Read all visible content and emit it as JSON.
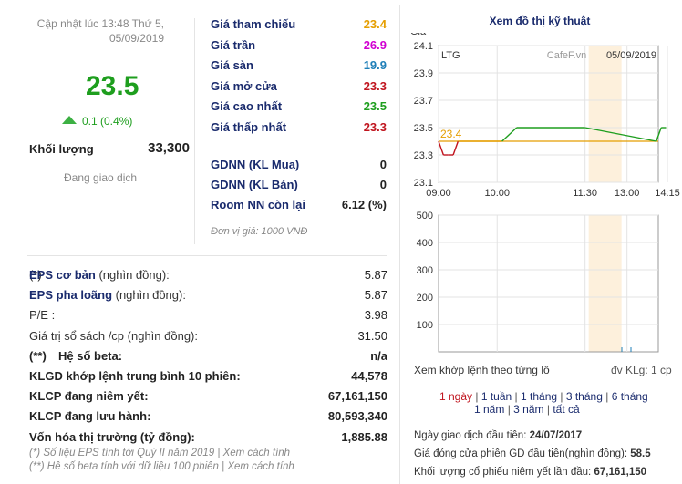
{
  "quote": {
    "updated_line1": "Cập nhật lúc 13:48 Thứ 5,",
    "updated_line2": "05/09/2019",
    "price": "23.5",
    "change": "0.1 (0.4%)",
    "volume_label": "Khối lượng",
    "volume": "33,300",
    "status": "Đang giao dịch"
  },
  "price_table": [
    {
      "label": "Giá tham chiếu",
      "value": "23.4",
      "color": "#e59e00"
    },
    {
      "label": "Giá trần",
      "value": "26.9",
      "color": "#d100d1"
    },
    {
      "label": "Giá sàn",
      "value": "19.9",
      "color": "#1f7fb8"
    },
    {
      "label": "Giá mở cửa",
      "value": "23.3",
      "color": "#c0141e"
    },
    {
      "label": "Giá cao nhất",
      "value": "23.5",
      "color": "#1e9e1e"
    },
    {
      "label": "Giá thấp nhất",
      "value": "23.3",
      "color": "#c0141e"
    }
  ],
  "foreign_table": [
    {
      "label": "GDNN (KL Mua)",
      "value": "0"
    },
    {
      "label": "GDNN (KL Bán)",
      "value": "0"
    },
    {
      "label": "Room NN còn lại",
      "value": "6.12 (%)"
    }
  ],
  "unit_note": "Đơn vị giá: 1000 VNĐ",
  "fundamentals": [
    {
      "prefix": "(*)",
      "label": "EPS cơ bản",
      "suffix": " (nghìn đồng):",
      "value": "5.87",
      "style": "link"
    },
    {
      "prefix": "",
      "label": "EPS pha loãng",
      "suffix": " (nghìn đồng):",
      "value": "5.87",
      "style": "link"
    },
    {
      "prefix": "",
      "label": "P/E",
      "suffix": " :",
      "value": "3.98",
      "style": "plain"
    },
    {
      "prefix": "",
      "label": "Giá trị sổ sách /cp",
      "suffix": " (nghìn đồng):",
      "value": "31.50",
      "style": "plain"
    },
    {
      "prefix": "(**)",
      "label": "Hệ số beta",
      "suffix": ":",
      "value": "n/a",
      "style": "bold"
    },
    {
      "prefix": "",
      "label": "KLGD khớp lệnh trung bình 10 phiên",
      "suffix": ":",
      "value": "44,578",
      "style": "bold"
    },
    {
      "prefix": "",
      "label": "KLCP đang niêm yết",
      "suffix": ":",
      "value": "67,161,150",
      "style": "bold"
    },
    {
      "prefix": "",
      "label": "KLCP đang lưu hành",
      "suffix": ":",
      "value": "80,593,340",
      "style": "bold"
    },
    {
      "prefix": "",
      "label": "Vốn hóa thị trường",
      "suffix": " (tỷ đồng):",
      "value": "1,885.88",
      "style": "bold"
    }
  ],
  "notes": [
    "(*) Số liệu EPS tính tới Quý II năm 2019 | Xem cách tính",
    "(**) Hệ số beta tính với dữ liệu 100 phiên | Xem cách tính"
  ],
  "chart_panel": {
    "title": "Xem đồ thị kỹ thuật",
    "detail_link": "Xem khớp lệnh theo từng lô",
    "unit": "đv KLg: 1 cp",
    "ranges_row1": [
      "1 ngày",
      "1 tuần",
      "1 tháng",
      "3 tháng",
      "6 tháng"
    ],
    "ranges_row2": [
      "1 năm",
      "3 năm",
      "tất cả"
    ],
    "active_range": "1 ngày",
    "active_color": "#c0141e",
    "link_color": "#1a2b6d",
    "first_trade_label": "Ngày giao dịch đầu tiên: ",
    "first_trade_value": "24/07/2017",
    "first_close_label": "Giá đóng cửa phiên GD đầu tiên(nghìn đồng): ",
    "first_close_value": "58.5",
    "first_listed_label": "Khối lượng cổ phiếu niêm yết lần đầu: ",
    "first_listed_value": "67,161,150"
  },
  "chart_data": [
    {
      "type": "line",
      "ylabel": "Giá",
      "ticker": "LTG",
      "watermark": "CafeF.vn",
      "date": "05/09/2019",
      "x_ticks": [
        "09:00",
        "10:00",
        "11:30",
        "13:00",
        "14:15"
      ],
      "y_ticks": [
        "24.1",
        "23.9",
        "23.7",
        "23.5",
        "23.3",
        "23.1"
      ],
      "ylim": [
        23.1,
        24.1
      ],
      "reference": 23.4,
      "reference_label": "23.4",
      "series": [
        {
          "x": [
            "09:00",
            "09:05",
            "09:10",
            "09:15",
            "09:20",
            "10:05",
            "10:20",
            "12:55",
            "13:30",
            "13:35",
            "13:40"
          ],
          "values": [
            23.4,
            23.3,
            23.3,
            23.3,
            23.4,
            23.4,
            23.5,
            23.5,
            23.4,
            23.5,
            23.5
          ]
        }
      ],
      "colors": {
        "up": "#1e9e1e",
        "down": "#c0141e",
        "reference": "#e59e00",
        "lunch_band": "#fdf0dc"
      }
    },
    {
      "type": "bar",
      "y_ticks": [
        "500",
        "400",
        "300",
        "200",
        "100"
      ],
      "ylim": [
        0,
        500
      ]
    }
  ]
}
